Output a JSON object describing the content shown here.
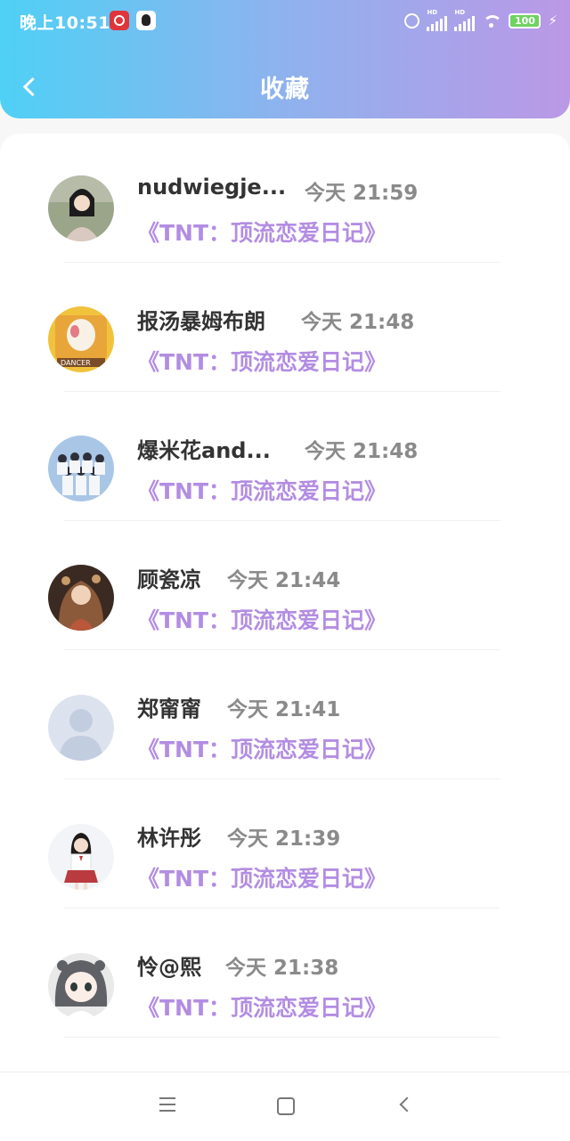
{
  "status_bar": {
    "time": "晚上10:51",
    "hd_label": "HD",
    "battery": "100"
  },
  "header": {
    "title": "收藏",
    "gradient": [
      "#4fd0f5",
      "#bb98e6"
    ]
  },
  "accent_color": "#b38de2",
  "favorites": [
    {
      "name": "nudwiegje...",
      "time": "今天 21:59",
      "book": "《TNT：顶流恋爱日记》"
    },
    {
      "name": "报汤暴姆布朗",
      "time": "今天 21:48",
      "book": "《TNT：顶流恋爱日记》"
    },
    {
      "name": "爆米花and...",
      "time": "今天 21:48",
      "book": "《TNT：顶流恋爱日记》"
    },
    {
      "name": "顾瓷凉",
      "time": "今天 21:44",
      "book": "《TNT：顶流恋爱日记》"
    },
    {
      "name": "郑甯甯",
      "time": "今天 21:41",
      "book": "《TNT：顶流恋爱日记》"
    },
    {
      "name": "林许彤",
      "time": "今天 21:39",
      "book": "《TNT：顶流恋爱日记》"
    },
    {
      "name": "怜@熙",
      "time": "今天 21:38",
      "book": "《TNT：顶流恋爱日记》"
    }
  ],
  "nav_bar": {
    "icons": [
      "menu-icon",
      "home-icon",
      "back-icon"
    ]
  }
}
